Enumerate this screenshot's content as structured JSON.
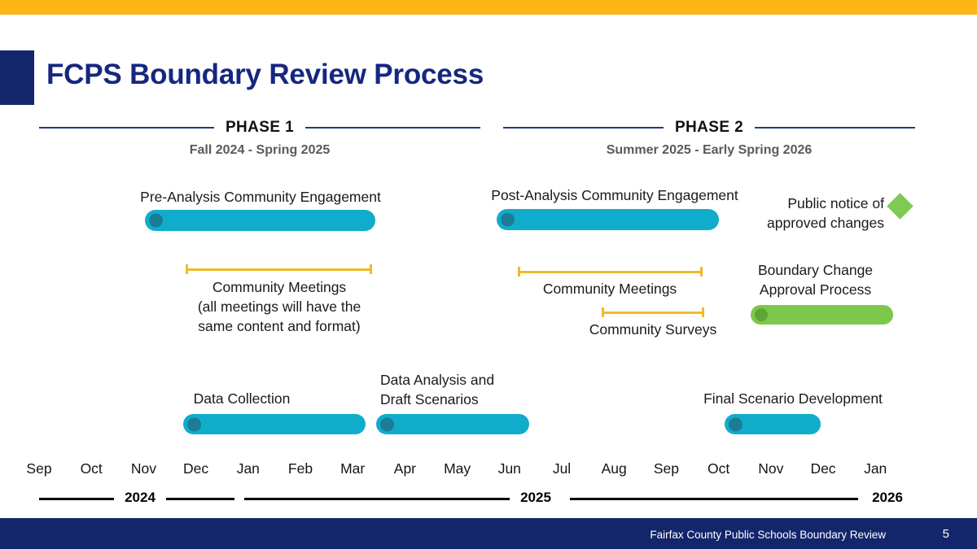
{
  "slide": {
    "title": "FCPS Boundary Review Process",
    "accent_top_color": "#FDB415",
    "brand_navy": "#14266B",
    "title_color": "#16277F"
  },
  "phases": [
    {
      "label": "PHASE 1",
      "subtitle": "Fall 2024 - Spring 2025"
    },
    {
      "label": "PHASE 2",
      "subtitle": "Summer 2025 - Early Spring 2026"
    }
  ],
  "tracks": {
    "pre_analysis": {
      "label": "Pre-Analysis Community Engagement",
      "color": "#10ACCB",
      "knob_color": "#1B7C95"
    },
    "post_analysis": {
      "label": "Post-Analysis Community Engagement",
      "color": "#10ACCB",
      "knob_color": "#1B7C95"
    },
    "public_notice": {
      "label": "Public notice of\napproved changes",
      "marker": "diamond-marker",
      "color": "#80C952"
    },
    "community_meetings_p1": {
      "label": "Community Meetings\n(all meetings will have the\nsame content and format)",
      "color": "#EFBA2B"
    },
    "community_meetings_p2": {
      "label": "Community Meetings",
      "color": "#EFBA2B"
    },
    "community_surveys": {
      "label": "Community Surveys",
      "color": "#EFBA2B"
    },
    "boundary_change": {
      "label": "Boundary Change\nApproval Process",
      "color": "#7DC84A",
      "knob_color": "#5FA536"
    },
    "data_collection": {
      "label": "Data Collection",
      "color": "#10ACCB",
      "knob_color": "#1B7C95"
    },
    "data_analysis": {
      "label": "Data Analysis and\nDraft Scenarios",
      "color": "#10ACCB",
      "knob_color": "#1B7C95"
    },
    "final_scenario": {
      "label": "Final Scenario Development",
      "color": "#10ACCB",
      "knob_color": "#1B7C95"
    }
  },
  "timeline": {
    "months": [
      "Sep",
      "Oct",
      "Nov",
      "Dec",
      "Jan",
      "Feb",
      "Mar",
      "Apr",
      "May",
      "Jun",
      "Jul",
      "Aug",
      "Sep",
      "Oct",
      "Nov",
      "Dec",
      "Jan"
    ],
    "years": [
      "2024",
      "2025",
      "2026"
    ]
  },
  "footer": {
    "text": "Fairfax County Public Schools Boundary Review",
    "page": "5"
  }
}
